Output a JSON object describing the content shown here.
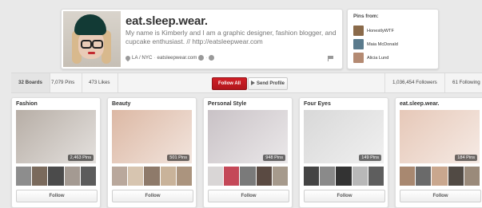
{
  "profile": {
    "name": "eat.sleep.wear.",
    "bio": "My name is Kimberly and I am a graphic designer, fashion blogger, and cupcake enthusiast. // http://eatsleepwear.com",
    "location": "LA / NYC",
    "website": "eatsleepwear.com"
  },
  "pins_from": {
    "title": "Pins from:",
    "sources": [
      {
        "label": "HonestlyWTF",
        "color": "#8a6a4a"
      },
      {
        "label": "Maia McDonald",
        "color": "#5a7a8c"
      },
      {
        "label": "Alicia Lund",
        "color": "#b48a72"
      }
    ]
  },
  "stats": {
    "boards": "32 Boards",
    "pins": "7,079 Pins",
    "likes": "473 Likes",
    "followers": "1,036,454 Followers",
    "following": "61 Following"
  },
  "actions": {
    "follow_all": "Follow All",
    "send_profile": "Send Profile"
  },
  "boards": [
    {
      "title": "Fashion",
      "pins": "2,463 Pins",
      "follow": "Follow",
      "cover": "#b7aea6",
      "thumbs": [
        "#8d8d8d",
        "#7a6a5c",
        "#4b4b4b",
        "#a49a92",
        "#5c5c5c"
      ]
    },
    {
      "title": "Beauty",
      "pins": "501 Pins",
      "follow": "Follow",
      "cover": "#dcb8a4",
      "thumbs": [
        "#b9a89c",
        "#d7c5b0",
        "#8e7a6a",
        "#c9b39a",
        "#ab947e"
      ]
    },
    {
      "title": "Personal Style",
      "pins": "948 Pins",
      "follow": "Follow",
      "cover": "#c9c2c6",
      "thumbs": [
        "#d9d6d6",
        "#c44858",
        "#7a7a7a",
        "#5a4a42",
        "#a69a8c"
      ]
    },
    {
      "title": "Four Eyes",
      "pins": "149 Pins",
      "follow": "Follow",
      "cover": "#d8d8d8",
      "thumbs": [
        "#444444",
        "#8a8a8a",
        "#333333",
        "#b8b8b8",
        "#5e5e5e"
      ]
    },
    {
      "title": "eat.sleep.wear.",
      "pins": "184 Pins",
      "follow": "Follow",
      "cover": "#e6c8b8",
      "thumbs": [
        "#a88870",
        "#6a6a6a",
        "#c9a78e",
        "#514a44",
        "#9a8a7a"
      ]
    }
  ]
}
